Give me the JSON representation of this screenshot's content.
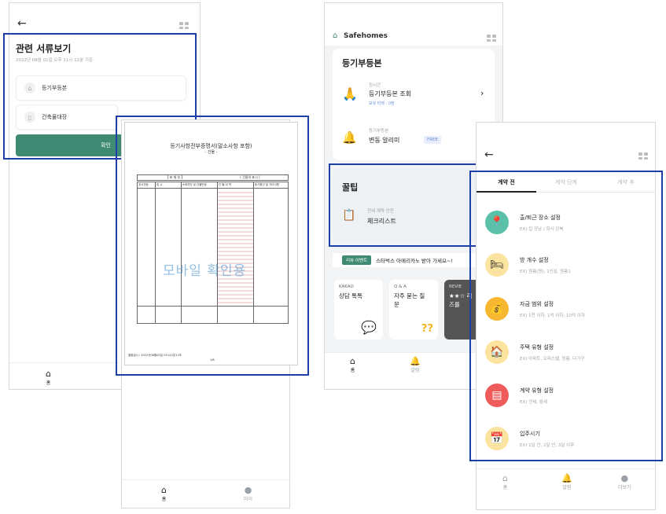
{
  "screen1": {
    "title": "관련 서류보기",
    "timestamp": "2022년 08월 01일 오후 11시 12분 기준",
    "docs": [
      {
        "label": "등기부등본",
        "icon": "house-icon"
      },
      {
        "label": "건축물대장",
        "icon": "document-icon"
      }
    ],
    "confirm_label": "확인",
    "nav_home": "홈"
  },
  "certificate": {
    "title": "등기사항전부증명서(말소사항 포함)",
    "subtitle": "- 건물 -",
    "watermark": "모바일 확인용",
    "section_header": "【 표 제 부 】",
    "section_sub": "( 건물의 표시 )",
    "col_headers": [
      "표시번호",
      "접 수",
      "소재지번 및 건물번호",
      "건 물 내 역",
      "등기원인 및 기타사항"
    ],
    "footer": "열람일시 : 2022년08월02일 23시12분13초",
    "page": "1/8",
    "nav_my": "마이"
  },
  "screen3": {
    "brand": "Safehomes",
    "registry_card_title": "등기부등본",
    "lookup": {
      "tag": "칭시간",
      "title": "등기부등본 조회",
      "sub": "보유 티켓 : 0장"
    },
    "alert": {
      "tag": "등기부등본",
      "title": "변동 알리미",
      "badge": "FREE"
    },
    "tips_title": "꿀팁",
    "checklist": {
      "tag": "전세 계약 안전",
      "title": "체크리스트"
    },
    "event": {
      "badge": "리뷰 이벤트",
      "text": "스타벅스 아메리카노 받아 가세요~!"
    },
    "tiles": [
      {
        "tag": "KAKAO",
        "title": "상담 톡톡"
      },
      {
        "tag": "Q & A",
        "title": "자주 묻는 질문"
      },
      {
        "tag": "REVIE",
        "title": "★★☆ 리즈를"
      }
    ],
    "nav": [
      {
        "label": "홈"
      },
      {
        "label": "알림"
      }
    ]
  },
  "screen4": {
    "tabs": [
      "계약 전",
      "계약 단계",
      "계약 후"
    ],
    "active_tab": "계약 전",
    "options": [
      {
        "title": "출/퇴근 장소 설정",
        "desc": "EX) 집 강남 / 회사 강북",
        "icon": "map-pin-icon",
        "color": "#e9a13b"
      },
      {
        "title": "방 개수 설정",
        "desc": "EX) 원룸(원), 1인실, 원룸1",
        "icon": "bed-icon",
        "color": "#ffd54f"
      },
      {
        "title": "자금 범위 설정",
        "desc": "EX) 1천 이하, 1억 이하, 10억 이하",
        "icon": "money-bag-icon",
        "color": "#f7b731"
      },
      {
        "title": "주택 유형 설정",
        "desc": "EX) 아파트, 오피스텔, 원룸, 다가구",
        "icon": "house-icon",
        "color": "#f2b134"
      },
      {
        "title": "계약 유형 설정",
        "desc": "EX) 전세, 월세",
        "icon": "document-icon",
        "color": "#ef5b5b"
      },
      {
        "title": "입주시기",
        "desc": "EX) 1달 안, 2달 안, 3달 이후",
        "icon": "calendar-icon",
        "color": "#ffd54f"
      }
    ],
    "nav": [
      {
        "label": "홈"
      },
      {
        "label": "알림"
      },
      {
        "label": "더보기"
      }
    ]
  },
  "colors": {
    "accent_green": "#3f8a73",
    "highlight_blue": "#1f3fa8",
    "tips_bg": "#eef1f4"
  }
}
